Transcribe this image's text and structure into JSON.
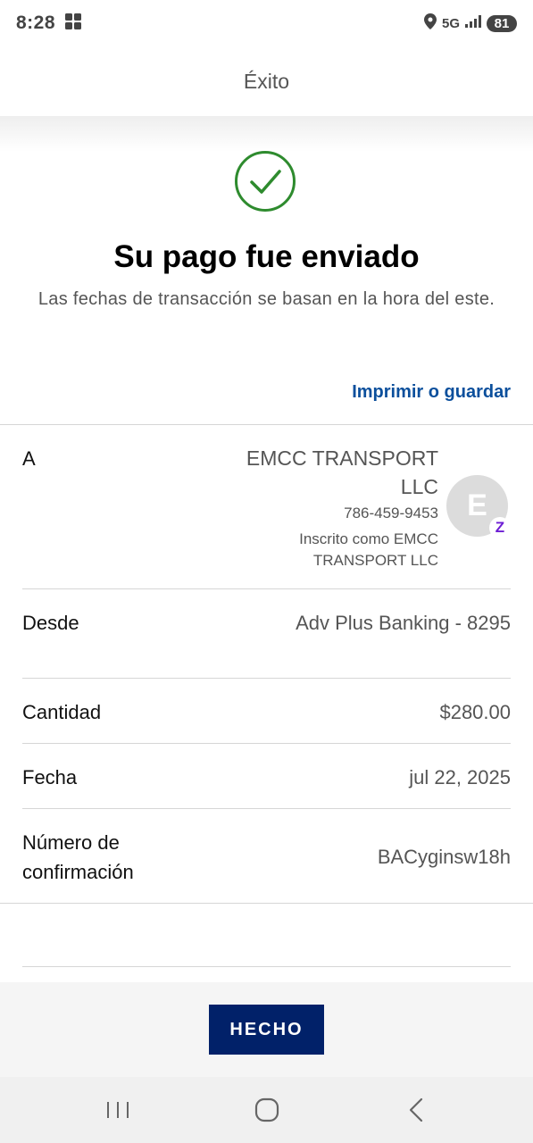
{
  "status_bar": {
    "time": "8:28",
    "network": "5G",
    "battery": "81"
  },
  "header": {
    "title": "Éxito"
  },
  "success": {
    "title": "Su pago fue enviado",
    "subtitle": "Las fechas de transacción se basan en la hora del este."
  },
  "print_link": "Imprimir o guardar",
  "payee": {
    "label": "A",
    "name": "EMCC TRANSPORT LLC",
    "phone": "786-459-9453",
    "enrolled": "Inscrito como EMCC TRANSPORT LLC",
    "avatar_initial": "E",
    "badge": "Z"
  },
  "details": [
    {
      "label": "Desde",
      "value": "Adv Plus Banking - 8295"
    },
    {
      "label": "Cantidad",
      "value": "$280.00"
    },
    {
      "label": "Fecha",
      "value": "jul 22, 2025"
    },
    {
      "label": "Número de confirmación",
      "value": "BACyginsw18h"
    }
  ],
  "done_button": "HECHO",
  "colors": {
    "accent_link": "#0b4f9c",
    "primary_button": "#012169",
    "success_green": "#2e8b2e",
    "zelle_purple": "#6d1ed4"
  },
  "icons": [
    "gallery-icon",
    "location-icon",
    "signal-icon",
    "check-circle-icon",
    "zelle-icon",
    "recent-apps-icon",
    "home-icon",
    "back-icon"
  ]
}
